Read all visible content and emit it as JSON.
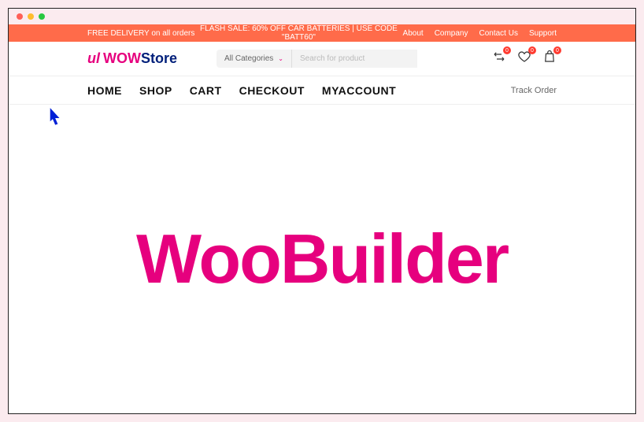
{
  "topbar": {
    "free_delivery": "FREE DELIVERY on all orders",
    "flash_sale": "FLASH SALE: 60% OFF CAR BATTERIES | USE CODE \"BATT60\"",
    "links": {
      "about": "About",
      "company": "Company",
      "contact": "Contact Us",
      "support": "Support"
    }
  },
  "logo": {
    "wow": "WOW",
    "store": "Store"
  },
  "search": {
    "category_label": "All Categories",
    "placeholder": "Search for product"
  },
  "header_icons": {
    "compare_badge": "0",
    "wishlist_badge": "0",
    "cart_badge": "0"
  },
  "nav": {
    "home": "HOME",
    "shop": "SHOP",
    "cart": "CART",
    "checkout": "CHECKOUT",
    "account": "MYACCOUNT",
    "track": "Track Order"
  },
  "hero": {
    "title": "WooBuilder"
  }
}
